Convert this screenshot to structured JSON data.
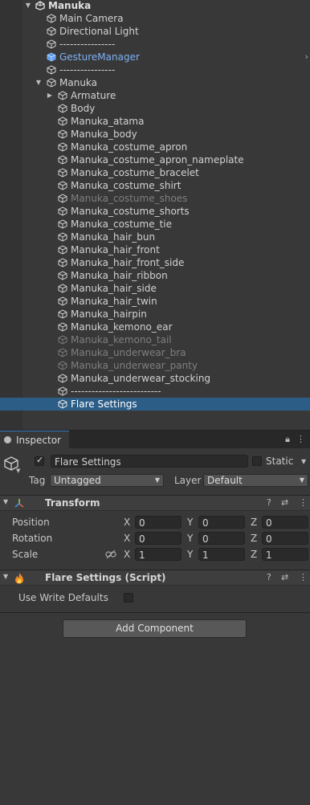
{
  "hierarchy": {
    "scene_root": "Manuka",
    "items": [
      {
        "label": "Main Camera"
      },
      {
        "label": "Directional Light"
      },
      {
        "label": "----------------"
      },
      {
        "label": "GestureManager"
      },
      {
        "label": "----------------"
      },
      {
        "label": "Manuka"
      },
      {
        "label": "Armature"
      },
      {
        "label": "Body"
      },
      {
        "label": "Manuka_atama"
      },
      {
        "label": "Manuka_body"
      },
      {
        "label": "Manuka_costume_apron"
      },
      {
        "label": "Manuka_costume_apron_nameplate"
      },
      {
        "label": "Manuka_costume_bracelet"
      },
      {
        "label": "Manuka_costume_shirt"
      },
      {
        "label": "Manuka_costume_shoes"
      },
      {
        "label": "Manuka_costume_shorts"
      },
      {
        "label": "Manuka_costume_tie"
      },
      {
        "label": "Manuka_hair_bun"
      },
      {
        "label": "Manuka_hair_front"
      },
      {
        "label": "Manuka_hair_front_side"
      },
      {
        "label": "Manuka_hair_ribbon"
      },
      {
        "label": "Manuka_hair_side"
      },
      {
        "label": "Manuka_hair_twin"
      },
      {
        "label": "Manuka_hairpin"
      },
      {
        "label": "Manuka_kemono_ear"
      },
      {
        "label": "Manuka_kemono_tail"
      },
      {
        "label": "Manuka_underwear_bra"
      },
      {
        "label": "Manuka_underwear_panty"
      },
      {
        "label": "Manuka_underwear_stocking"
      },
      {
        "label": "--------------------------"
      },
      {
        "label": "Flare Settings"
      }
    ]
  },
  "inspector": {
    "tab_label": "Inspector",
    "object_name": "Flare Settings",
    "static_label": "Static",
    "tag_label": "Tag",
    "tag_value": "Untagged",
    "layer_label": "Layer",
    "layer_value": "Default",
    "transform": {
      "title": "Transform",
      "position_label": "Position",
      "rotation_label": "Rotation",
      "scale_label": "Scale",
      "x_label": "X",
      "y_label": "Y",
      "z_label": "Z",
      "position": {
        "x": "0",
        "y": "0",
        "z": "0"
      },
      "rotation": {
        "x": "0",
        "y": "0",
        "z": "0"
      },
      "scale": {
        "x": "1",
        "y": "1",
        "z": "1"
      }
    },
    "script": {
      "title": "Flare Settings (Script)",
      "use_write_defaults_label": "Use Write Defaults"
    },
    "add_component_label": "Add Component"
  },
  "colors": {
    "selection": "#2c5d87",
    "prefab_blue": "#7fb0f5",
    "panel": "#383838"
  }
}
